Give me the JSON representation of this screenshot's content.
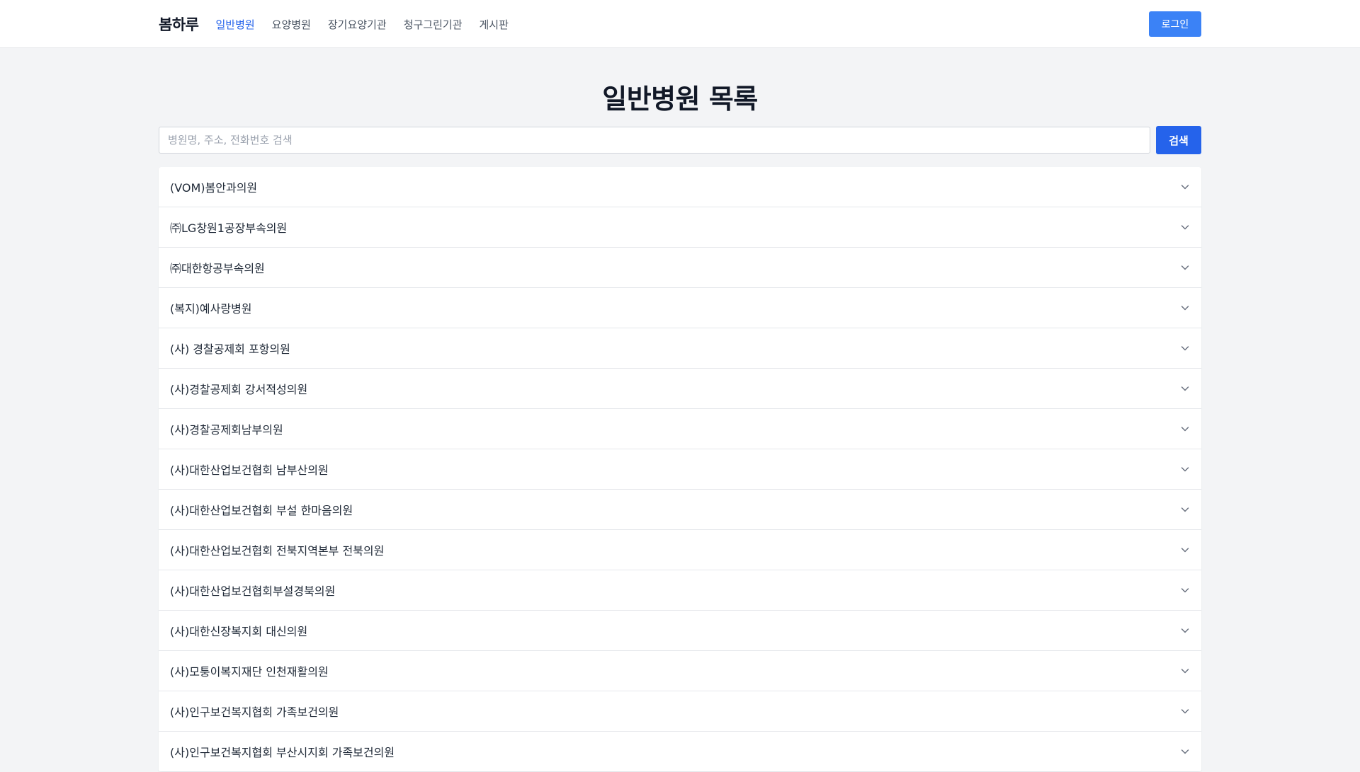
{
  "header": {
    "brand": "봄하루",
    "nav": [
      {
        "label": "일반병원",
        "active": true
      },
      {
        "label": "요양병원",
        "active": false
      },
      {
        "label": "장기요양기관",
        "active": false
      },
      {
        "label": "청구그린기관",
        "active": false
      },
      {
        "label": "게시판",
        "active": false
      }
    ],
    "login_label": "로그인"
  },
  "main": {
    "title": "일반병원 목록",
    "search": {
      "placeholder": "병원명, 주소, 전화번호 검색",
      "value": "",
      "button_label": "검색"
    },
    "hospitals": [
      "(VOM)봄안과의원",
      "㈜LG창원1공장부속의원",
      "㈜대한항공부속의원",
      "(복지)예사랑병원",
      "(사) 경찰공제회 포항의원",
      "(사)경찰공제회 강서적성의원",
      "(사)경찰공제회남부의원",
      "(사)대한산업보건협회 남부산의원",
      "(사)대한산업보건협회 부설 한마음의원",
      "(사)대한산업보건협회 전북지역본부 전북의원",
      "(사)대한산업보건협회부설경북의원",
      "(사)대한신장복지회 대신의원",
      "(사)모퉁이복지재단 인천재활의원",
      "(사)인구보건복지협회 가족보건의원",
      "(사)인구보건복지협회 부산시지회 가족보건의원"
    ]
  },
  "icons": {
    "item_expand": "chevron-down-icon"
  },
  "colors": {
    "accent": "#2563eb",
    "button": "#3b82f6",
    "background": "#f3f4f6"
  }
}
